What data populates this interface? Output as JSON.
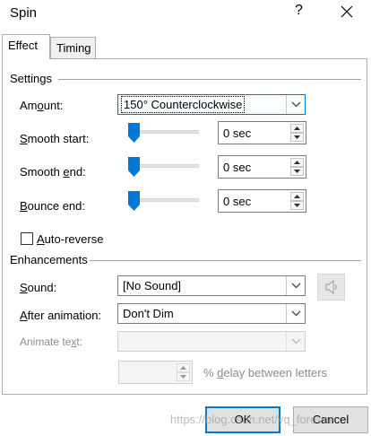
{
  "window": {
    "title": "Spin",
    "help_glyph": "?",
    "close_glyph": "✕"
  },
  "tabs": [
    {
      "label": "Effect",
      "active": true
    },
    {
      "label": "Timing",
      "active": false
    }
  ],
  "settings": {
    "header": "Settings",
    "amount": {
      "label_pre": "Am",
      "label_ul": "o",
      "label_post": "unt:",
      "value": "150° Counterclockwise"
    },
    "smooth_start": {
      "label_pre": "",
      "label_ul": "S",
      "label_post": "mooth start:",
      "value": "0 sec",
      "slider_level": 0
    },
    "smooth_end": {
      "label_pre": "Smooth ",
      "label_ul": "e",
      "label_post": "nd:",
      "value": "0 sec",
      "slider_level": 0
    },
    "bounce_end": {
      "label_pre": "",
      "label_ul": "B",
      "label_post": "ounce end:",
      "value": "0 sec",
      "slider_level": 0
    },
    "auto_reverse": {
      "label_pre": "",
      "label_ul": "A",
      "label_post": "uto-reverse",
      "checked": false
    }
  },
  "enhancements": {
    "header": "Enhancements",
    "sound": {
      "label_pre": "",
      "label_ul": "S",
      "label_post": "ound:",
      "value": "[No Sound]"
    },
    "after_animation": {
      "label_pre": "",
      "label_ul": "A",
      "label_post": "fter animation:",
      "value": "Don't Dim"
    },
    "animate_text": {
      "label_pre": "Animate te",
      "label_ul": "x",
      "label_post": "t:",
      "value": ""
    },
    "delay": {
      "value": "",
      "label_pre": "% ",
      "label_ul": "d",
      "label_post": "elay between letters"
    }
  },
  "buttons": {
    "ok": "OK",
    "cancel": "Cancel"
  },
  "watermark": "https://blog.csdn.net/yq_forever",
  "colors": {
    "accent": "#0078d7",
    "disabled_text": "#8c8c8c"
  }
}
